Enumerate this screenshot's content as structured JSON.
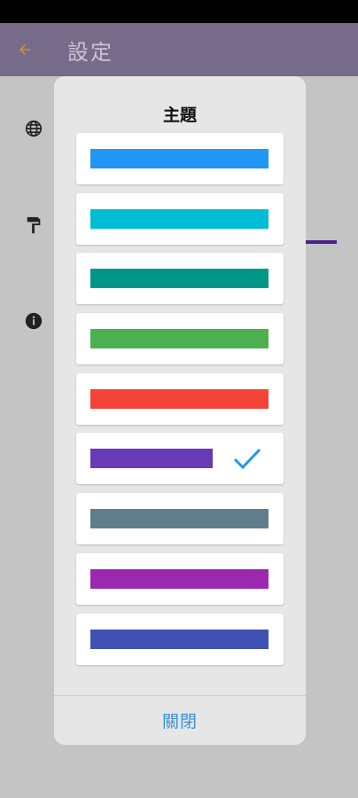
{
  "app_bar": {
    "title": "設定",
    "back_icon": "arrow-left-icon",
    "color": "#776b8a"
  },
  "settings_icons": [
    "globe-icon",
    "paint-roller-icon",
    "info-icon"
  ],
  "dialog": {
    "title": "主題",
    "close_label": "關閉",
    "themes": [
      {
        "color": "#2196f3",
        "selected": false
      },
      {
        "color": "#00bcd4",
        "selected": false
      },
      {
        "color": "#009688",
        "selected": false
      },
      {
        "color": "#4caf50",
        "selected": false
      },
      {
        "color": "#f44336",
        "selected": false
      },
      {
        "color": "#673ab7",
        "selected": true
      },
      {
        "color": "#607d8b",
        "selected": false
      },
      {
        "color": "#9c27b0",
        "selected": false
      },
      {
        "color": "#3f51b5",
        "selected": false
      }
    ]
  }
}
